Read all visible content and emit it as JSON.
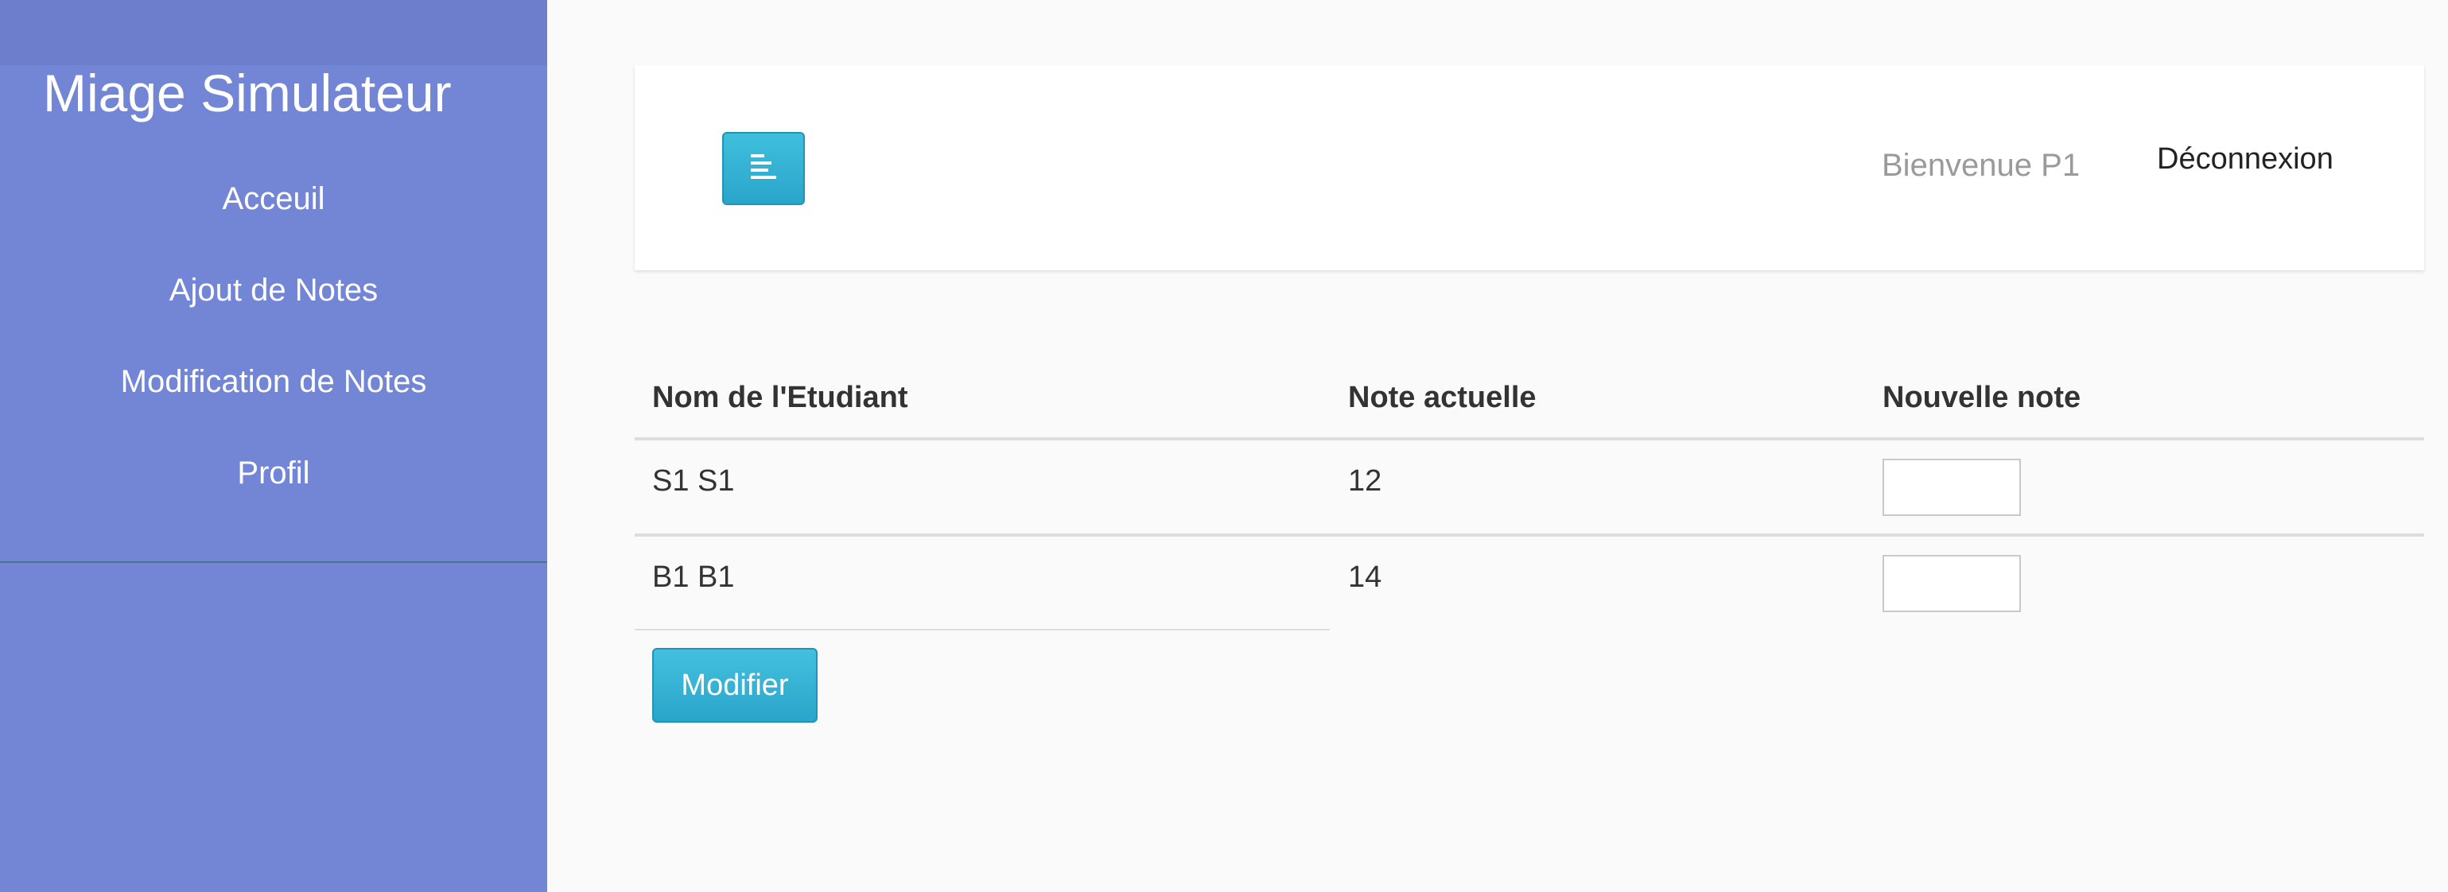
{
  "sidebar": {
    "brand": "Miage Simulateur",
    "items": [
      {
        "label": "Acceuil"
      },
      {
        "label": "Ajout de Notes"
      },
      {
        "label": "Modification de Notes"
      },
      {
        "label": "Profil"
      }
    ]
  },
  "navbar": {
    "toggle_icon": "align-left-icon",
    "welcome": "Bienvenue P1",
    "logout": "Déconnexion"
  },
  "table": {
    "headers": [
      "Nom de l'Etudiant",
      "Note actuelle",
      "Nouvelle note"
    ],
    "rows": [
      {
        "name": "S1 S1",
        "current": "12",
        "new_value": ""
      },
      {
        "name": "B1 B1",
        "current": "14",
        "new_value": ""
      }
    ]
  },
  "form": {
    "submit_label": "Modifier"
  },
  "colors": {
    "sidebar": "#7386d5",
    "sidebar_header": "#6d7fcc",
    "accent": "#2aa5cb",
    "background": "#fafafa"
  }
}
